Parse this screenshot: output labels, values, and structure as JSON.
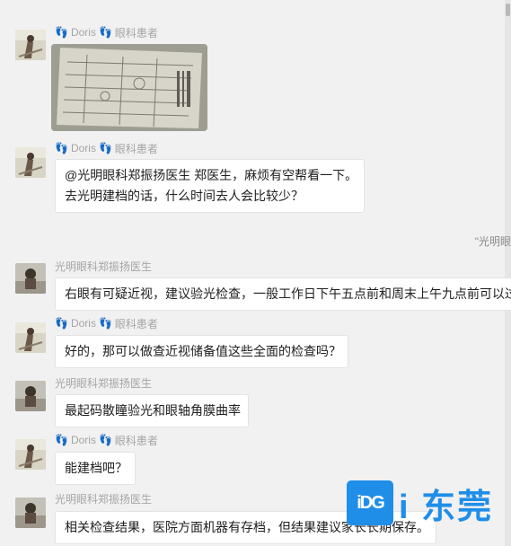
{
  "patient_tag": "眼科患者",
  "messages": [
    {
      "id": "m1",
      "sender": "Doris",
      "is_patient": true,
      "type": "image"
    },
    {
      "id": "m2",
      "sender": "Doris",
      "is_patient": true,
      "type": "text",
      "lines": [
        "@光明眼科郑振扬医生 郑医生，麻烦有空帮看一下。",
        "去光明建档的话，什么时间去人会比较少？"
      ]
    },
    {
      "id": "m3",
      "sender": "光明眼科郑振扬医生",
      "is_patient": false,
      "type": "text",
      "lines": [
        "右眼有可疑近视，建议验光检查，一般工作日下午五点前和周末上午九点前可以过"
      ]
    },
    {
      "id": "m4",
      "sender": "Doris",
      "is_patient": true,
      "type": "text",
      "lines": [
        "好的，那可以做查近视储备值这些全面的检查吗？"
      ]
    },
    {
      "id": "m5",
      "sender": "光明眼科郑振扬医生",
      "is_patient": false,
      "type": "text",
      "lines": [
        "最起码散瞳验光和眼轴角膜曲率"
      ]
    },
    {
      "id": "m6",
      "sender": "Doris",
      "is_patient": true,
      "type": "text",
      "lines": [
        "能建档吧？"
      ]
    },
    {
      "id": "m7",
      "sender": "光明眼科郑振扬医生",
      "is_patient": false,
      "type": "text",
      "lines": [
        "相关检查结果，医院方面机器有存档，但结果建议家长长期保存。"
      ]
    }
  ],
  "quote_fragment": "\"光明眼",
  "watermark": {
    "logo": "iDG",
    "text": "i 东莞"
  }
}
